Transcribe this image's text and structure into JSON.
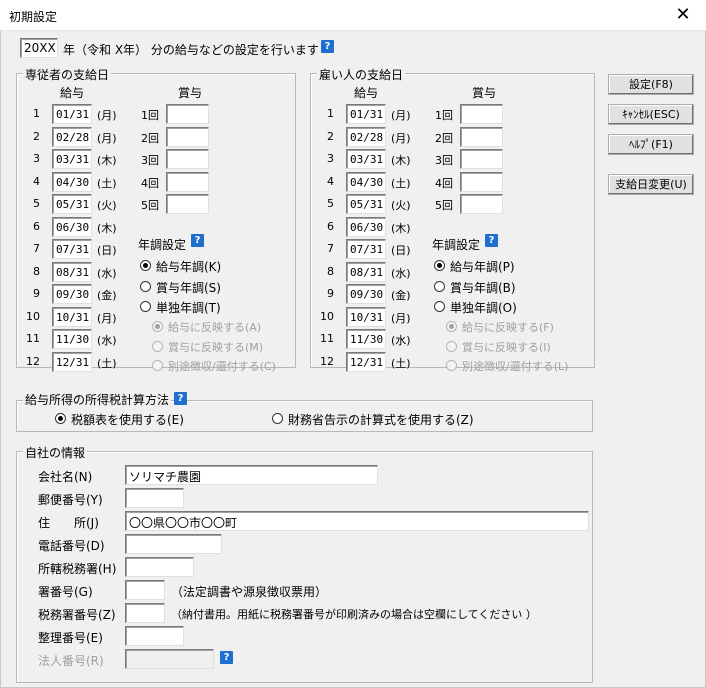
{
  "window": {
    "title": "初期設定",
    "close": "✕"
  },
  "header": {
    "year_value": "20XX",
    "text": "年（令和 X年） 分の給与などの設定を行います"
  },
  "help_glyph": "?",
  "sections": {
    "left": {
      "title": "専従者の支給日",
      "salary_label": "給与",
      "bonus_label": "賞与",
      "year_end_label": "年調設定",
      "rows": [
        {
          "n": "1",
          "date": "01/31",
          "dow": "(月)"
        },
        {
          "n": "2",
          "date": "02/28",
          "dow": "(月)"
        },
        {
          "n": "3",
          "date": "03/31",
          "dow": "(木)"
        },
        {
          "n": "4",
          "date": "04/30",
          "dow": "(土)"
        },
        {
          "n": "5",
          "date": "05/31",
          "dow": "(火)"
        },
        {
          "n": "6",
          "date": "06/30",
          "dow": "(木)"
        },
        {
          "n": "7",
          "date": "07/31",
          "dow": "(日)"
        },
        {
          "n": "8",
          "date": "08/31",
          "dow": "(水)"
        },
        {
          "n": "9",
          "date": "09/30",
          "dow": "(金)"
        },
        {
          "n": "10",
          "date": "10/31",
          "dow": "(月)"
        },
        {
          "n": "11",
          "date": "11/30",
          "dow": "(水)"
        },
        {
          "n": "12",
          "date": "12/31",
          "dow": "(土)"
        }
      ],
      "bonus": [
        "1回",
        "2回",
        "3回",
        "4回",
        "5回"
      ],
      "options": [
        "給与年調(K)",
        "賞与年調(S)",
        "単独年調(T)"
      ],
      "sub_options": [
        "給与に反映する(A)",
        "賞与に反映する(M)",
        "別途徴収/還付する(C)"
      ]
    },
    "right": {
      "title": "雇い人の支給日",
      "salary_label": "給与",
      "bonus_label": "賞与",
      "year_end_label": "年調設定",
      "rows": [
        {
          "n": "1",
          "date": "01/31",
          "dow": "(月)"
        },
        {
          "n": "2",
          "date": "02/28",
          "dow": "(月)"
        },
        {
          "n": "3",
          "date": "03/31",
          "dow": "(木)"
        },
        {
          "n": "4",
          "date": "04/30",
          "dow": "(土)"
        },
        {
          "n": "5",
          "date": "05/31",
          "dow": "(火)"
        },
        {
          "n": "6",
          "date": "06/30",
          "dow": "(木)"
        },
        {
          "n": "7",
          "date": "07/31",
          "dow": "(日)"
        },
        {
          "n": "8",
          "date": "08/31",
          "dow": "(水)"
        },
        {
          "n": "9",
          "date": "09/30",
          "dow": "(金)"
        },
        {
          "n": "10",
          "date": "10/31",
          "dow": "(月)"
        },
        {
          "n": "11",
          "date": "11/30",
          "dow": "(水)"
        },
        {
          "n": "12",
          "date": "12/31",
          "dow": "(土)"
        }
      ],
      "bonus": [
        "1回",
        "2回",
        "3回",
        "4回",
        "5回"
      ],
      "options": [
        "給与年調(P)",
        "賞与年調(B)",
        "単独年調(O)"
      ],
      "sub_options": [
        "給与に反映する(F)",
        "賞与に反映する(I)",
        "別途徴収/還付する(L)"
      ]
    }
  },
  "buttons": {
    "settings": "設定(F8)",
    "cancel": "ｷｬﾝｾﾙ(ESC)",
    "help": "ﾍﾙﾌﾟ(F1)",
    "payday_change": "支給日変更(U)"
  },
  "tax": {
    "title": "給与所得の所得税計算方法",
    "opt1": "税額表を使用する(E)",
    "opt2": "財務省告示の計算式を使用する(Z)"
  },
  "company": {
    "title": "自社の情報",
    "name_label": "会社名(N)",
    "name_value": "ソリマチ農園",
    "postal_label": "郵便番号(Y)",
    "postal_value": "",
    "address_label": "住　　所(J)",
    "address_value": "〇〇県〇〇市〇〇町",
    "phone_label": "電話番号(D)",
    "phone_value": "",
    "office_label": "所轄税務署(H)",
    "office_value": "",
    "office_no_label": "署番号(G)",
    "office_no_note": "（法定調書や源泉徴収票用）",
    "tax_office_no_label": "税務署番号(Z)",
    "tax_office_no_note": "（納付書用。用紙に税務署番号が印刷済みの場合は空欄にしてください ）",
    "ref_label": "整理番号(E)",
    "ref_value": "",
    "corp_label": "法人番号(R)",
    "corp_value": ""
  }
}
